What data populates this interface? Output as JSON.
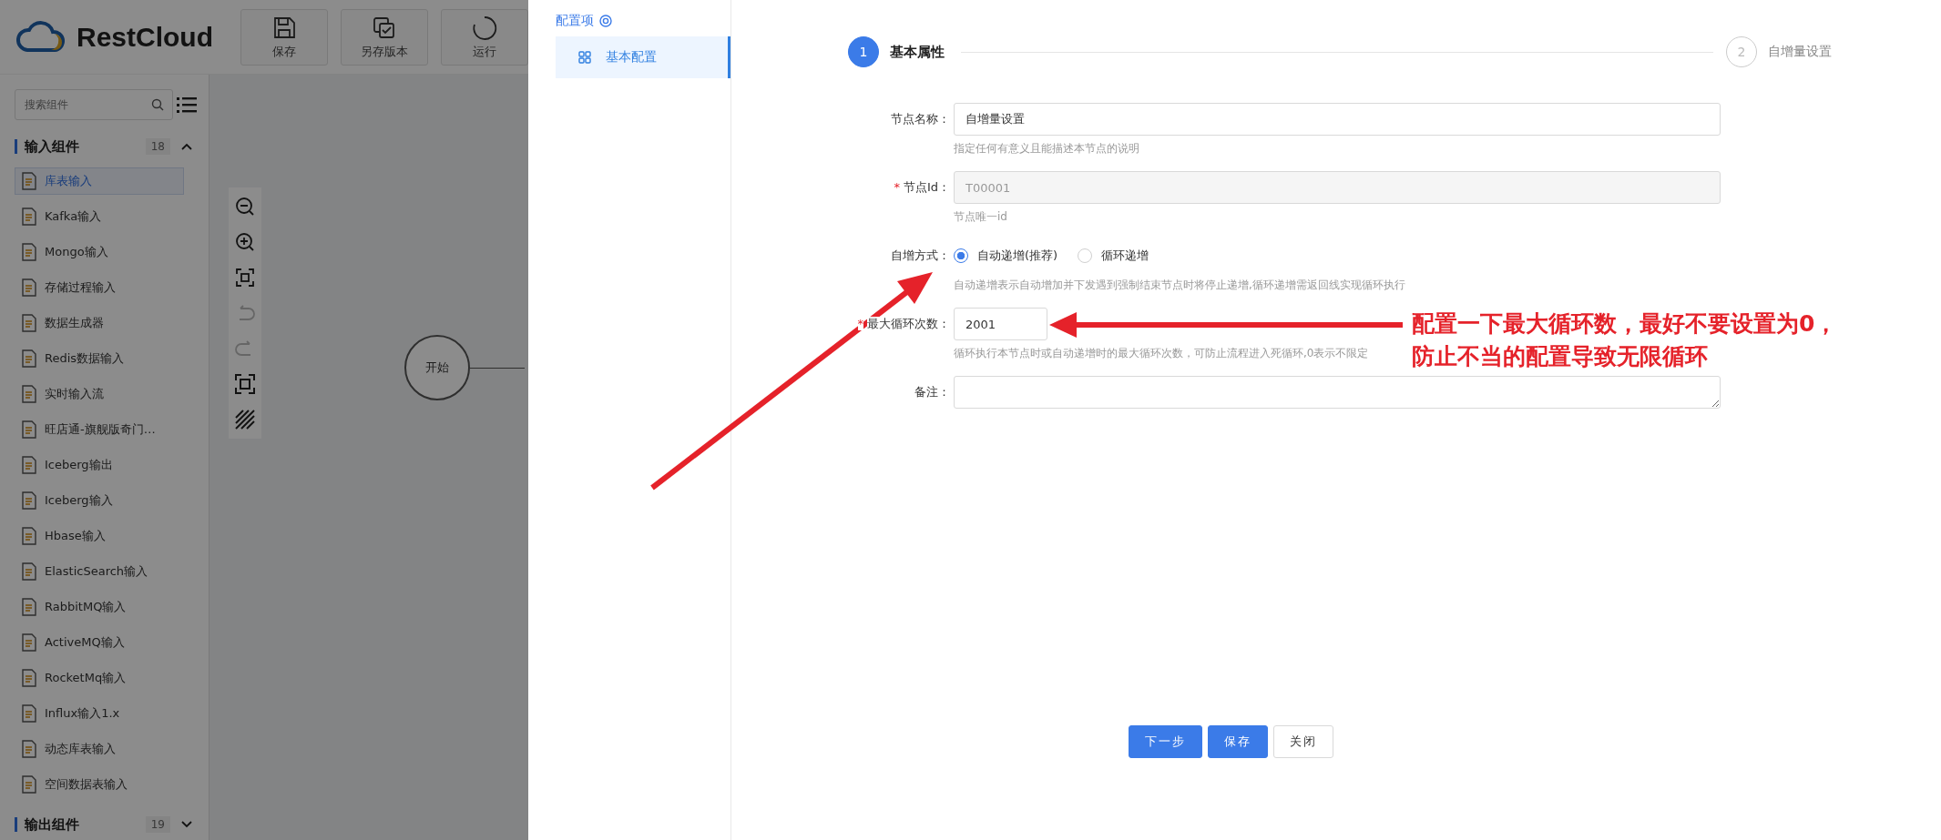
{
  "app": {
    "logo": "RestCloud",
    "toolbar": [
      {
        "kind": "save",
        "label": "保存"
      },
      {
        "kind": "copy",
        "label": "另存版本"
      },
      {
        "kind": "run",
        "label": "运行"
      }
    ],
    "search": {
      "placeholder": "搜索组件"
    },
    "groups": [
      {
        "title": "输入组件",
        "count": "18",
        "expanded": true,
        "items": [
          {
            "label": "库表输入",
            "selected": true
          },
          {
            "label": "Kafka输入",
            "selected": false
          },
          {
            "label": "Mongo输入",
            "selected": false
          },
          {
            "label": "存储过程输入",
            "selected": false
          },
          {
            "label": "数据生成器",
            "selected": false
          },
          {
            "label": "Redis数据输入",
            "selected": false
          },
          {
            "label": "实时输入流",
            "selected": false
          },
          {
            "label": "旺店通-旗舰版奇门…",
            "selected": false
          },
          {
            "label": "Iceberg输出",
            "selected": false
          },
          {
            "label": "Iceberg输入",
            "selected": false
          },
          {
            "label": "Hbase输入",
            "selected": false
          },
          {
            "label": "ElasticSearch输入",
            "selected": false
          },
          {
            "label": "RabbitMQ输入",
            "selected": false
          },
          {
            "label": "ActiveMQ输入",
            "selected": false
          },
          {
            "label": "RocketMq输入",
            "selected": false
          },
          {
            "label": "Influx输入1.x",
            "selected": false
          },
          {
            "label": "动态库表输入",
            "selected": false
          },
          {
            "label": "空间数据表输入",
            "selected": false
          }
        ]
      },
      {
        "title": "输出组件",
        "count": "19",
        "expanded": false
      }
    ],
    "canvas": {
      "tools": [
        {
          "kind": "zoom-out",
          "disabled": false
        },
        {
          "kind": "zoom-in",
          "disabled": false
        },
        {
          "kind": "fit",
          "disabled": false
        },
        {
          "kind": "undo",
          "disabled": true
        },
        {
          "kind": "redo",
          "disabled": true
        },
        {
          "kind": "frame",
          "disabled": false
        },
        {
          "kind": "hatch",
          "disabled": false
        }
      ],
      "nodes": [
        {
          "label": "开始"
        }
      ]
    }
  },
  "drawer": {
    "menu_title": "配置项",
    "menu": [
      {
        "label": "基本配置",
        "selected": true
      }
    ],
    "steps": [
      {
        "number": "1",
        "title": "基本属性",
        "active": true
      },
      {
        "number": "2",
        "title": "自增量设置",
        "active": false
      }
    ],
    "fields": [
      {
        "kind": "text",
        "label": "节点名称：",
        "value": "自增量设置",
        "help": "指定任何有意义且能描述本节点的说明"
      },
      {
        "kind": "text",
        "label": "节点Id：",
        "required_mark": "*",
        "disabled": true,
        "value": "T00001",
        "help": "节点唯一id"
      },
      {
        "kind": "radio",
        "label": "自增方式：",
        "options": [
          {
            "label": "自动递增(推荐)",
            "selected": true
          },
          {
            "label": "循环递增",
            "selected": false
          }
        ],
        "help": "自动递增表示自动增加并下发遇到强制结束节点时将停止递增,循环递增需返回线实现循环执行"
      },
      {
        "kind": "short",
        "label": "最大循环次数：",
        "required_mark": "*",
        "value": "2001",
        "help": "循环执行本节点时或自动递增时的最大循环次数，可防止流程进入死循环,0表示不限定"
      },
      {
        "kind": "textarea",
        "label": "备注："
      }
    ],
    "buttons": [
      {
        "kind": "primary",
        "label": "下一步"
      },
      {
        "kind": "primary",
        "label": "保存"
      },
      {
        "kind": "default",
        "label": "关闭"
      }
    ]
  },
  "annotation": {
    "lines": [
      "配置一下最大循环数，最好不要设置为0，",
      "防止不当的配置导致无限循环"
    ]
  }
}
